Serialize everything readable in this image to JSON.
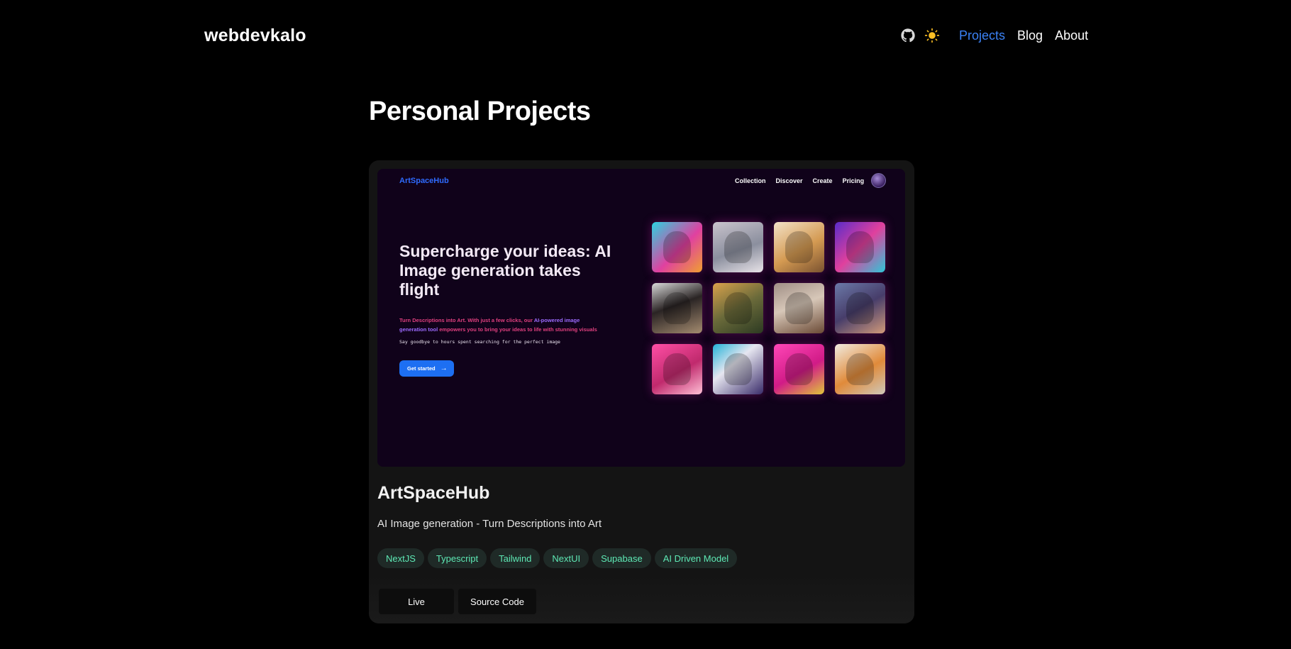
{
  "header": {
    "logo": "webdevkalo",
    "icons": [
      "github-icon",
      "sun-icon"
    ],
    "nav": [
      {
        "label": "Projects",
        "active": true
      },
      {
        "label": "Blog",
        "active": false
      },
      {
        "label": "About",
        "active": false
      }
    ]
  },
  "page": {
    "title": "Personal Projects"
  },
  "project": {
    "title": "ArtSpaceHub",
    "description": "AI Image generation - Turn Descriptions into Art",
    "tags": [
      "NextJS",
      "Typescript",
      "Tailwind",
      "NextUI",
      "Supabase",
      "AI Driven Model"
    ],
    "buttons": {
      "live": "Live",
      "source": "Source Code"
    },
    "preview": {
      "logo": "ArtSpaceHub",
      "nav": [
        "Collection",
        "Discover",
        "Create",
        "Pricing"
      ],
      "hero": "Supercharge your ideas: AI Image generation takes flight",
      "desc_part1": "Turn Descriptions into Art. With just a few clicks, our ",
      "desc_part2": "AI-powered image generation tool",
      "desc_part3": " empowers you to bring your ideas to life with stunning visuals",
      "tagline": "Say goodbye to hours spent searching for the perfect image",
      "cta": "Get started",
      "tiles": [
        "linear-gradient(135deg,#2bd3e0 0%,#e040a0 55%,#f0a030 100%)",
        "linear-gradient(160deg,#c9c3cc 0%,#8b8f9e 55%,#e8e3e8 100%)",
        "linear-gradient(150deg,#f3e2c8 0%,#d49a52 55%,#7a5230 100%)",
        "linear-gradient(135deg,#5a2cc9 0%,#e0409d 50%,#2fc7d8 100%)",
        "linear-gradient(160deg,#d9d9d9 0%,#2a2424 45%,#a58c70 100%)",
        "linear-gradient(150deg,#d9a24c 0%,#6a6a3a 50%,#2c3a22 100%)",
        "linear-gradient(160deg,#a08f86 0%,#d7c7b8 45%,#6b4a35 100%)",
        "linear-gradient(150deg,#6b79a8 0%,#473d6a 50%,#d29a7a 100%)",
        "linear-gradient(150deg,#ff4fa6 0%,#c02a6d 55%,#ffc0d6 100%)",
        "linear-gradient(140deg,#24b3d8 0%,#e6e6f0 40%,#3a2c6a 100%)",
        "linear-gradient(150deg,#ff47b8 0%,#d11b87 55%,#e0c63a 100%)",
        "linear-gradient(150deg,#f1ebe0 0%,#e08a3a 55%,#cfc8ba 100%)"
      ]
    }
  }
}
